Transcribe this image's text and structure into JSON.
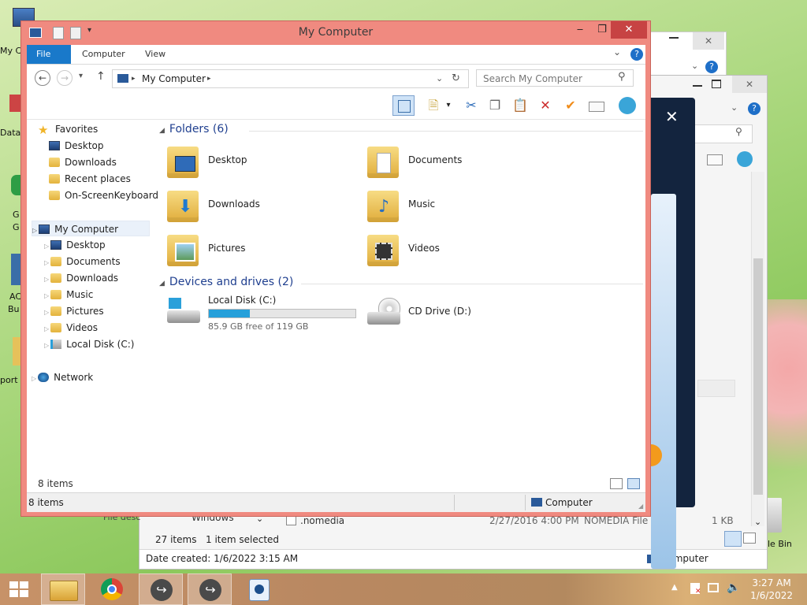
{
  "desktop": {
    "icons": [
      "My C",
      "Data",
      "G",
      "G",
      "AC",
      "Bu",
      "port",
      "le Bin"
    ]
  },
  "bg_window": {
    "file_row": {
      "folder": "Windows",
      "name": ".nomedia",
      "date": "2/27/2016 4:00 PM",
      "type": "NOMEDIA File",
      "size": "1 KB",
      "desc": "File desc"
    },
    "status": {
      "count": "27 items",
      "selected": "1 item selected"
    },
    "bottom": {
      "date": "Date created: 1/6/2022 3:15 AM",
      "location": "Computer"
    }
  },
  "window": {
    "title": "My Computer",
    "ribbon": {
      "tabs": [
        "File",
        "Computer",
        "View"
      ]
    },
    "address": {
      "path": "My Computer"
    },
    "search": {
      "placeholder": "Search My Computer"
    },
    "nav": {
      "favorites_label": "Favorites",
      "favorites": [
        "Desktop",
        "Downloads",
        "Recent places",
        "On-ScreenKeyboard"
      ],
      "computer_label": "My Computer",
      "computer": [
        "Desktop",
        "Documents",
        "Downloads",
        "Music",
        "Pictures",
        "Videos",
        "Local Disk (C:)"
      ],
      "network_label": "Network"
    },
    "content": {
      "folders_header": "Folders (6)",
      "folders": [
        "Desktop",
        "Documents",
        "Downloads",
        "Music",
        "Pictures",
        "Videos"
      ],
      "drives_header": "Devices and drives (2)",
      "drives": [
        {
          "name": "Local Disk (C:)",
          "free": "85.9 GB free of 119 GB",
          "used_fraction": 0.28
        },
        {
          "name": "CD Drive (D:)"
        }
      ]
    },
    "status": {
      "items": "8 items"
    },
    "statusbar": {
      "items": "8 items",
      "location": "Computer"
    }
  },
  "taskbar": {
    "time": "3:27 AM",
    "date": "1/6/2022"
  },
  "colors": {
    "accent": "#1979ca",
    "window_frame": "#f08a80",
    "close": "#c74343",
    "drive_fill": "#26a0da"
  }
}
